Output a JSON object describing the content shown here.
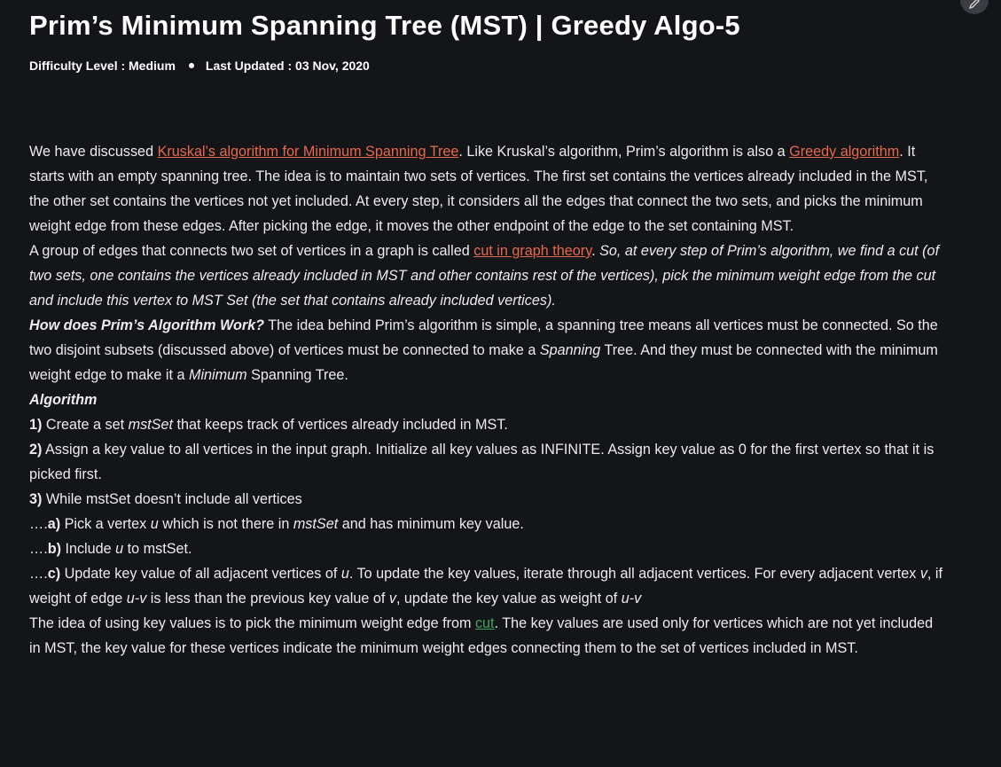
{
  "title": "Prim’s Minimum Spanning Tree (MST) | Greedy Algo-5",
  "meta": {
    "difficulty": "Difficulty Level : Medium",
    "updated": "Last Updated : 03 Nov, 2020"
  },
  "colors": {
    "background": "#141519",
    "link": "#e8684a",
    "link_alt": "#3da55d",
    "text": "#ececec"
  },
  "icons": {
    "fab": "pencil-icon"
  },
  "p1": {
    "t1": "We have discussed ",
    "link1": "Kruskal’s algorithm for Minimum Spanning Tree",
    "t2": ". Like Kruskal’s algorithm, Prim’s algorithm is also a ",
    "link2": "Greedy algorithm",
    "t3": ". It starts with an empty spanning tree. The idea is to maintain two sets of vertices. The first set contains the vertices already included in the MST, the other set contains the vertices not yet included. At every step, it considers all the edges that connect the two sets, and picks the minimum weight edge from these edges. After picking the edge, it moves the other endpoint of the edge to the set containing MST."
  },
  "p2": {
    "t1": "A group of edges that connects two set of vertices in a graph is called ",
    "link": "cut in graph theory",
    "t2": ". ",
    "em": "So, at every step of Prim’s algorithm, we find a cut (of two sets, one contains the vertices already included in MST and other contains rest of the vertices), pick the minimum weight edge from the cut and include this vertex to MST Set (the set that contains already included vertices)."
  },
  "p3": {
    "heading": "How does Prim’s Algorithm Work?",
    "t1": " The idea behind Prim’s algorithm is simple, a spanning tree means all vertices must be connected. So the two disjoint subsets (discussed above) of vertices must be connected to make a ",
    "em1": "Spanning",
    "t2": " Tree. And they must be connected with the minimum weight edge to make it a ",
    "em2": "Minimum",
    "t3": " Spanning Tree."
  },
  "algo": {
    "heading": "Algorithm",
    "s1_num": "1)",
    "s1_t1": " Create a set ",
    "s1_em": "mstSet",
    "s1_t2": " that keeps track of vertices already included in MST.",
    "s2_num": "2)",
    "s2_t": " Assign a key value to all vertices in the input graph. Initialize all key values as INFINITE. Assign key value as 0 for the first vertex so that it is picked first.",
    "s3_num": "3)",
    "s3_t": " While mstSet doesn’t include all vertices",
    "a_prefix": "….",
    "a_num": "a)",
    "a_t1": " Pick a vertex ",
    "a_em1": "u",
    "a_t2": " which is not there in ",
    "a_em2": "mstSet",
    "a_t3": " and has minimum key value.",
    "b_prefix": "….",
    "b_num": "b)",
    "b_t1": " Include ",
    "b_em": "u",
    "b_t2": " to mstSet.",
    "c_prefix": "….",
    "c_num": "c)",
    "c_t1": " Update key value of all adjacent vertices of ",
    "c_em1": "u",
    "c_t2": ". To update the key values, iterate through all adjacent vertices. For every adjacent vertex ",
    "c_em2": "v",
    "c_t3": ", if weight of edge ",
    "c_em3": "u-v",
    "c_t4": " is less than the previous key value of ",
    "c_em4": "v",
    "c_t5": ", update the key value as weight of ",
    "c_em5": "u-v"
  },
  "p4": {
    "t1": "The idea of using key values is to pick the minimum weight edge from ",
    "link": "cut",
    "t2": ". The key values are used only for vertices which are not yet included in MST, the key value for these vertices indicate the minimum weight edges connecting them to the set of vertices included in MST."
  }
}
